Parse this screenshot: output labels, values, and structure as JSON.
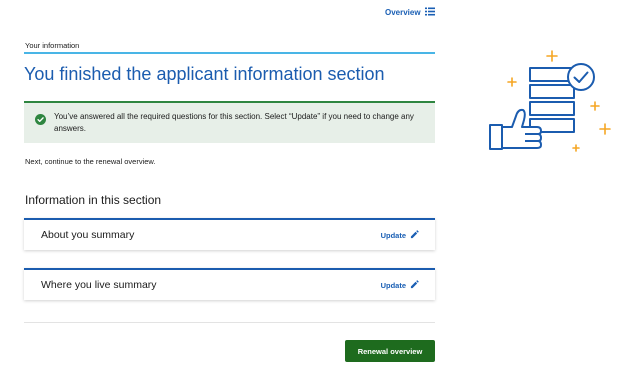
{
  "header": {
    "overview_link": "Overview",
    "overview_icon": "list-icon"
  },
  "section": {
    "label": "Your information",
    "title": "You finished the applicant information section"
  },
  "alert": {
    "icon": "check-circle-icon",
    "message": "You’ve answered all the required questions for this section. Select “Update” if you need to change any answers.",
    "color": "#2e8540"
  },
  "next_text": "Next, continue to the renewal overview.",
  "info": {
    "heading": "Information in this section",
    "cards": [
      {
        "title": "About you summary",
        "action": "Update",
        "action_icon": "pencil-icon"
      },
      {
        "title": "Where you live summary",
        "action": "Update",
        "action_icon": "pencil-icon"
      }
    ]
  },
  "footer": {
    "button_label": "Renewal overview",
    "button_color": "#1e6b1e"
  },
  "colors": {
    "primary_blue": "#1b5caf",
    "accent_orange": "#f5a623",
    "rule_cyan": "#49b5e6"
  }
}
